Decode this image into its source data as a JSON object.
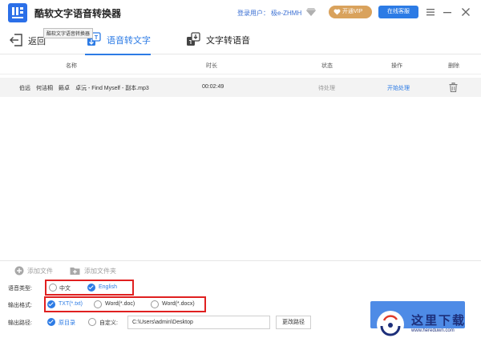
{
  "app": {
    "title": "酷软文字语音转换器",
    "tooltip": "酷软文字语音转换器",
    "login_label": "登录用户：",
    "username": "极e-ZHMH",
    "vip_label": "开通VIP",
    "service_label": "在线客服"
  },
  "icons": {
    "logo": "app-logo-icon",
    "gem": "diamond-icon",
    "heart": "heart-icon",
    "menu": "hamburger-icon",
    "minimize": "minimize-icon",
    "close": "close-icon",
    "back": "back-arrow-icon",
    "tab_stt": "speech-to-text-icon",
    "tab_tts": "text-to-speech-icon",
    "delete": "trash-icon",
    "add_file": "plus-circle-icon",
    "add_folder": "folder-plus-icon"
  },
  "colors": {
    "accent": "#2c7be5",
    "vip": "#d9a25c",
    "highlight_border": "#e02020",
    "watermark": "#1d2f7a"
  },
  "nav": {
    "back_label": "返回",
    "tabs": [
      {
        "label": "语音转文字",
        "active": true
      },
      {
        "label": "文字转语音",
        "active": false
      }
    ]
  },
  "table": {
    "headers": {
      "name": "名称",
      "duration": "时长",
      "status": "状态",
      "action": "操作",
      "delete": "删除"
    },
    "rows": [
      {
        "name": "伯远　何洁桐　籁卓　卓沅 - Find Myself - 副本.mp3",
        "duration": "00:02:49",
        "status": "待处理",
        "action": "开始处理"
      }
    ]
  },
  "toolbar": {
    "add_file": "添加文件",
    "add_folder": "添加文件夹"
  },
  "options": {
    "language": {
      "label": "语音类型:",
      "choices": [
        "中文",
        "English"
      ],
      "selected": "English"
    },
    "format": {
      "label": "输出格式:",
      "choices": [
        "TXT(*.txt)",
        "Word(*.doc)",
        "Word(*.docx)"
      ],
      "selected": "TXT(*.txt)"
    },
    "output_path": {
      "label": "输出路径:",
      "choices": [
        "原目录",
        "自定义:"
      ],
      "selected": "原目录",
      "value": "C:\\Users\\admin\\Desktop",
      "change_label": "更改路径"
    }
  },
  "watermark": {
    "text": "这里下载",
    "url": "www.hereduwn.com"
  }
}
